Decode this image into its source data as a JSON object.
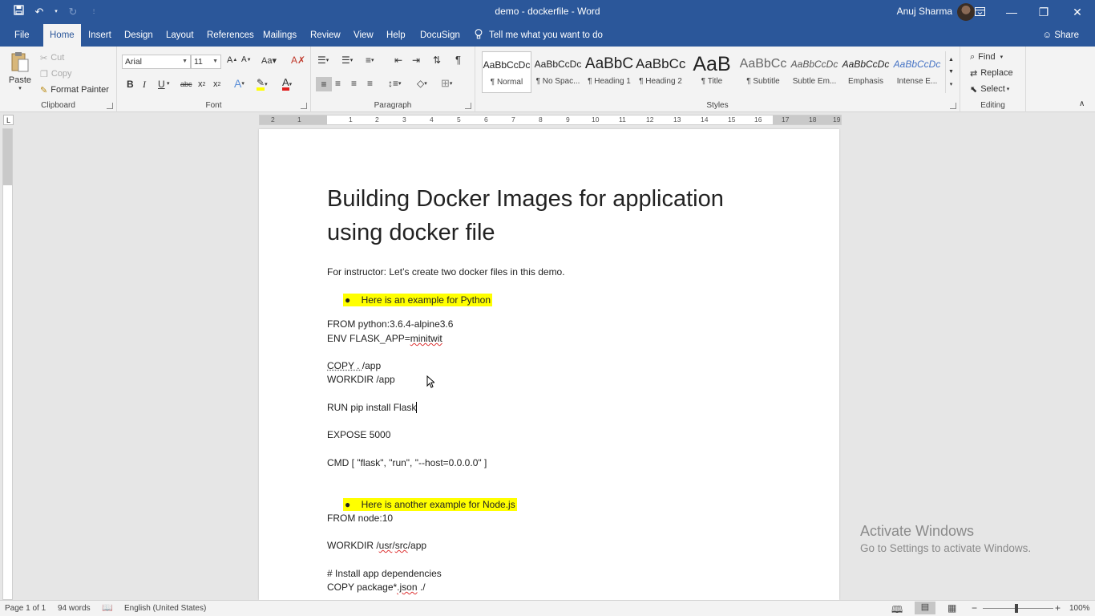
{
  "window": {
    "title": "demo - dockerfile - Word",
    "user": "Anuj Sharma"
  },
  "tabs": [
    "File",
    "Home",
    "Insert",
    "Design",
    "Layout",
    "References",
    "Mailings",
    "Review",
    "View",
    "Help",
    "DocuSign"
  ],
  "active_tab": "Home",
  "tell_me": "Tell me what you want to do",
  "share": "Share",
  "clipboard": {
    "paste": "Paste",
    "cut": "Cut",
    "copy": "Copy",
    "format_painter": "Format Painter",
    "label": "Clipboard"
  },
  "font": {
    "name": "Arial",
    "size": "11",
    "label": "Font"
  },
  "paragraph": {
    "label": "Paragraph"
  },
  "styles": {
    "label": "Styles",
    "items": [
      {
        "sample": "AaBbCcDc",
        "name": "¶ Normal"
      },
      {
        "sample": "AaBbCcDc",
        "name": "¶ No Spac..."
      },
      {
        "sample": "AaBbC",
        "name": "¶ Heading 1"
      },
      {
        "sample": "AaBbCc",
        "name": "¶ Heading 2"
      },
      {
        "sample": "AaB",
        "name": "¶ Title"
      },
      {
        "sample": "AaBbCc",
        "name": "¶ Subtitle"
      },
      {
        "sample": "AaBbCcDc",
        "name": "Subtle Em..."
      },
      {
        "sample": "AaBbCcDc",
        "name": "Emphasis"
      },
      {
        "sample": "AaBbCcDc",
        "name": "Intense E..."
      }
    ]
  },
  "editing": {
    "find": "Find",
    "replace": "Replace",
    "select": "Select",
    "label": "Editing"
  },
  "ruler": [
    "2",
    "1",
    "1",
    "2",
    "3",
    "4",
    "5",
    "6",
    "7",
    "8",
    "9",
    "10",
    "11",
    "12",
    "13",
    "14",
    "15",
    "16",
    "17",
    "18",
    "19"
  ],
  "document": {
    "heading_line1": "Building Docker Images for application",
    "heading_line2": "using docker file",
    "intro": "For instructor: Let’s create two docker files in this demo.",
    "bullet1": "Here is an example for Python",
    "py_from": "FROM python:3.6.4-alpine3.6",
    "py_env_prefix": "ENV FLASK_APP=",
    "py_env_value": "minitwit",
    "py_copy_prefix": "COPY . ",
    "py_copy_rest": "/app",
    "py_workdir": "WORKDIR /app",
    "py_run": "RUN pip install Flask",
    "py_expose": "EXPOSE 5000",
    "py_cmd": "CMD [ \"flask\", \"run\", \"--host=0.0.0.0\" ]",
    "bullet2": "Here is another example for Node.js",
    "node_from": "FROM node:10",
    "node_workdir_prefix": "WORKDIR /",
    "node_workdir_usr": "usr",
    "node_workdir_slash": "/",
    "node_workdir_src": "src",
    "node_workdir_rest": "/app",
    "node_comment": "# Install app dependencies",
    "node_copy_prefix": "COPY package",
    "node_copy_star": "*",
    "node_copy_json": ".json",
    "node_copy_rest": " ./"
  },
  "status": {
    "page": "Page 1 of 1",
    "words": "94 words",
    "language": "English (United States)",
    "zoom": "100%"
  },
  "watermark": {
    "line1": "Activate Windows",
    "line2": "Go to Settings to activate Windows."
  },
  "colors": {
    "accent": "#2b579a",
    "highlight": "#ffff00"
  }
}
